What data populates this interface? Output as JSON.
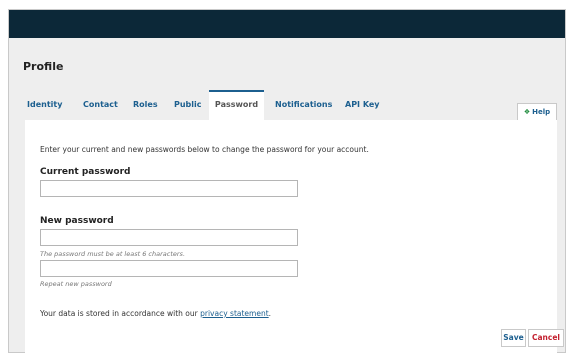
{
  "header": {
    "page_title": "Profile"
  },
  "tabs": [
    {
      "label": "Identity"
    },
    {
      "label": "Contact"
    },
    {
      "label": "Roles"
    },
    {
      "label": "Public"
    },
    {
      "label": "Password",
      "active": true
    },
    {
      "label": "Notifications"
    },
    {
      "label": "API Key"
    }
  ],
  "help": {
    "icon": "help-icon",
    "label": "Help"
  },
  "form": {
    "intro": "Enter your current and new passwords below to change the password for your account.",
    "current_password_label": "Current password",
    "current_password_value": "",
    "new_password_label": "New password",
    "new_password_value": "",
    "new_password_hint": "The password must be at least 6 characters.",
    "repeat_password_value": "",
    "repeat_password_hint": "Repeat new password",
    "privacy_text": "Your data is stored in accordance with our",
    "privacy_link": "privacy statement",
    "privacy_suffix": "."
  },
  "actions": {
    "save_label": "Save",
    "cancel_label": "Cancel"
  },
  "colors": {
    "header_bg": "#0c2838",
    "link": "#1c5f8f",
    "cancel": "#c3202f",
    "help_icon": "#1c8a3b",
    "background": "#eeeeee"
  }
}
